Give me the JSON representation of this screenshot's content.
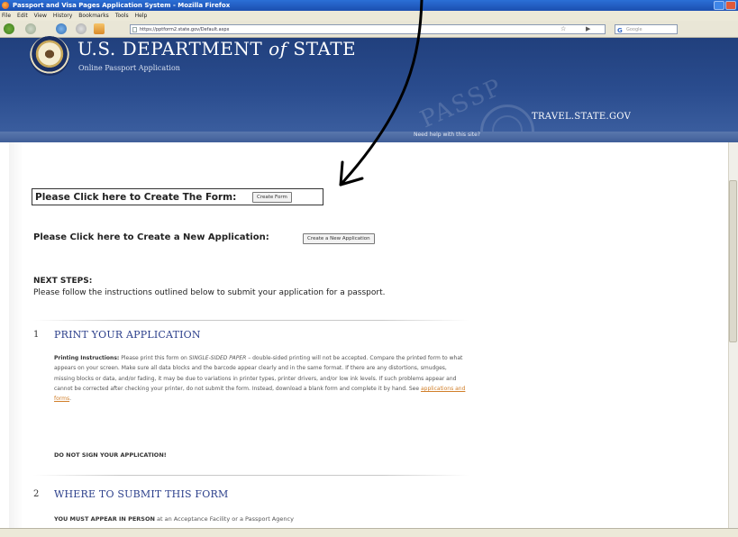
{
  "browser": {
    "window_title": "Passport and Visa Pages Application System - Mozilla Firefox",
    "menu": [
      "File",
      "Edit",
      "View",
      "History",
      "Bookmarks",
      "Tools",
      "Help"
    ],
    "url": "https://pptform2.state.gov/Default.aspx",
    "search_placeholder": "Google"
  },
  "banner": {
    "dept_prefix": "U.S. DEPARTMENT",
    "dept_of": "of",
    "dept_suffix": "STATE",
    "subtitle": "Online Passport Application",
    "watermark": "PASSP",
    "travel": "TRAVEL.STATE.GOV",
    "help_link": "Need help with this site?"
  },
  "main": {
    "create_form_label": "Please Click here to Create The Form:",
    "create_form_button": "Create Form",
    "new_app_label": "Please Click here to Create a New Application:",
    "new_app_button": "Create a New Application",
    "next_steps_title": "NEXT STEPS:",
    "next_steps_desc": "Please follow the instructions outlined below to submit your application for a passport."
  },
  "steps": [
    {
      "number": "1",
      "title": "PRINT YOUR APPLICATION",
      "instructions_label": "Printing Instructions:",
      "instructions_a": "Please print this form on",
      "instructions_paper": "SINGLE-SIDED PAPER",
      "instructions_b": "– double-sided printing will not be accepted. Compare the printed form to what appears on your screen. Make sure all data blocks and the barcode appear clearly and in the same format. If there are any distortions, smudges, missing blocks or data, and/or fading, it may be due to variations in printer types, printer drivers, and/or low ink levels. If such problems appear and cannot be corrected after checking your printer, do not submit the form. Instead, download a blank form and complete it by hand. See",
      "instructions_link": "applications and forms",
      "warning": "DO NOT SIGN YOUR APPLICATION!"
    },
    {
      "number": "2",
      "title": "WHERE TO SUBMIT THIS FORM",
      "appear_bold": "YOU MUST APPEAR IN PERSON",
      "appear_rest": "at an Acceptance Facility or a Passport Agency"
    }
  ],
  "colors": {
    "banner": "#2a4c8e",
    "step_title": "#2b3f8b",
    "link": "#d17f2a"
  }
}
